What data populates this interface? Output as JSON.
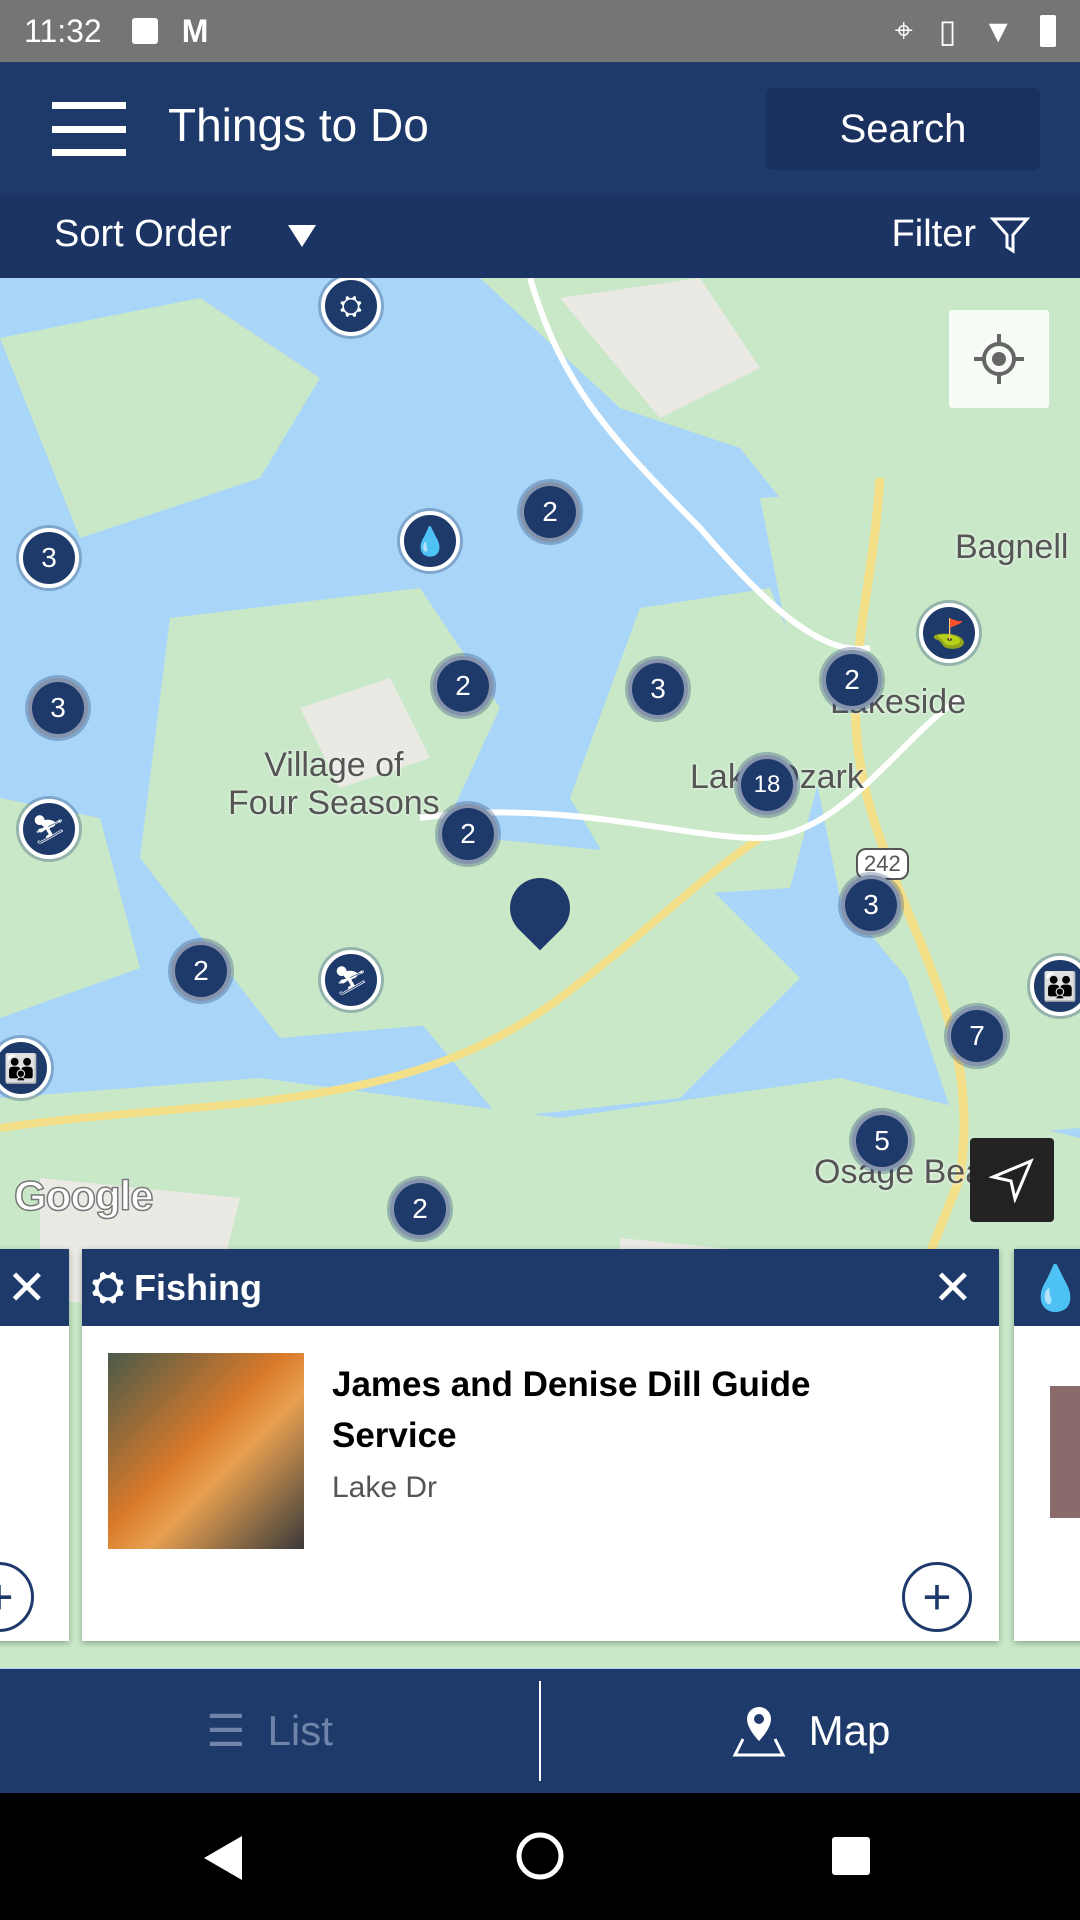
{
  "status_bar": {
    "time": "11:32",
    "icons": [
      "image-icon",
      "gmail-icon",
      "location-icon",
      "vibrate-icon",
      "wifi-icon",
      "battery-charging-icon"
    ]
  },
  "header": {
    "title": "Things to Do",
    "search_label": "Search"
  },
  "sort_bar": {
    "sort_label": "Sort Order",
    "filter_label": "Filter"
  },
  "map": {
    "labels": {
      "bagnell": "Bagnell",
      "lakeside": "Lakeside",
      "lake_ozark": "Lake Ozark",
      "village": "Village of\nFour Seasons",
      "osage": "Osage Beach",
      "route": "242"
    },
    "attribution": "Google",
    "clusters": [
      "2",
      "3",
      "3",
      "2",
      "3",
      "2",
      "18",
      "2",
      "3",
      "2",
      "7",
      "5",
      "2"
    ]
  },
  "cards": {
    "main": {
      "category": "Fishing",
      "name": "James and Denise Dill Guide Service",
      "address": "Lake Dr"
    }
  },
  "bottom_nav": {
    "list_label": "List",
    "map_label": "Map"
  },
  "colors": {
    "primary": "#1e3a6b",
    "water": "#a9d6f8",
    "land": "#c8e8c8"
  }
}
